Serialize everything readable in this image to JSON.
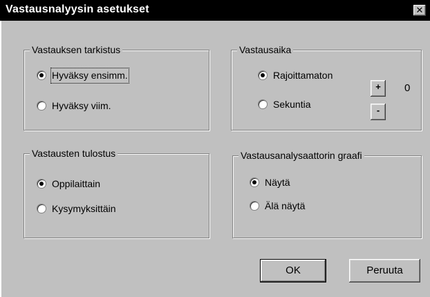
{
  "window": {
    "title": "Vastausnalyysin asetukset",
    "close_label": "✕"
  },
  "answer_check": {
    "label": "Vastauksen tarkistus",
    "options": [
      {
        "label": "Hyväksy ensimm.",
        "selected": true
      },
      {
        "label": "Hyväksy viim.",
        "selected": false
      }
    ]
  },
  "answer_time": {
    "label": "Vastausaika",
    "options": [
      {
        "label": "Rajoittamaton",
        "selected": true
      },
      {
        "label": "Sekuntia",
        "selected": false
      }
    ],
    "increment_label": "+",
    "decrement_label": "-",
    "value": "0"
  },
  "output": {
    "label": "Vastausten tulostus",
    "options": [
      {
        "label": "Oppilaittain",
        "selected": true
      },
      {
        "label": "Kysymyksittäin",
        "selected": false
      }
    ]
  },
  "graph": {
    "label": "Vastausanalysaattorin graafi",
    "options": [
      {
        "label": "Näytä",
        "selected": true
      },
      {
        "label": "Älä näytä",
        "selected": false
      }
    ]
  },
  "buttons": {
    "ok_label": "OK",
    "cancel_label": "Peruuta"
  }
}
